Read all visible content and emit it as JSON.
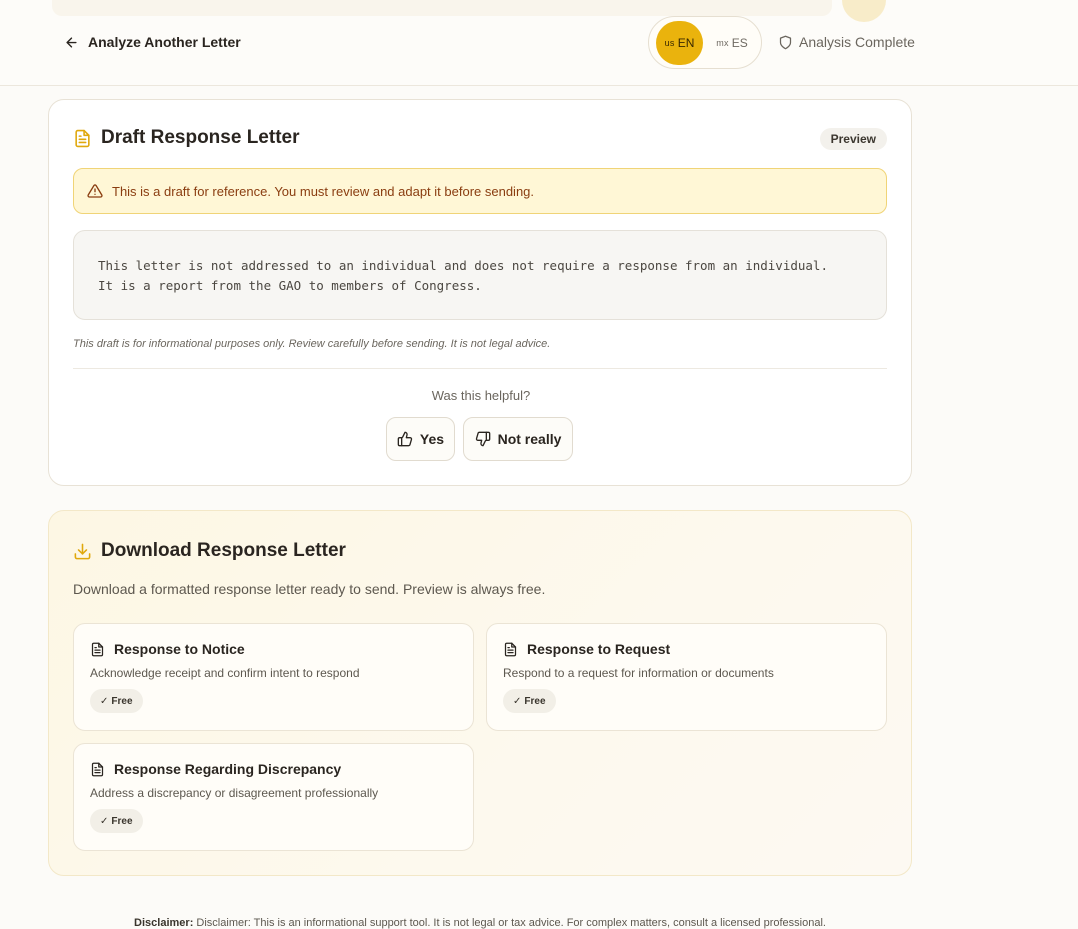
{
  "header": {
    "back_label": "Analyze Another Letter",
    "languages": [
      {
        "flag": "us",
        "code": "EN",
        "active": true
      },
      {
        "flag": "mx",
        "code": "ES",
        "active": false
      }
    ],
    "status": "Analysis Complete"
  },
  "draft": {
    "title": "Draft Response Letter",
    "badge": "Preview",
    "warning": "This is a draft for reference. You must review and adapt it before sending.",
    "letter_lines": [
      "This letter is not addressed to an individual and does not require a response from an individual.",
      "It is a report from the GAO to members of Congress."
    ],
    "note": "This draft is for informational purposes only. Review carefully before sending. It is not legal advice.",
    "feedback": {
      "question": "Was this helpful?",
      "yes": "Yes",
      "no": "Not really"
    }
  },
  "download": {
    "title": "Download Response Letter",
    "description": "Download a formatted response letter ready to send. Preview is always free.",
    "options": [
      {
        "title": "Response to Notice",
        "description": "Acknowledge receipt and confirm intent to respond",
        "badge": "Free",
        "check": "✓"
      },
      {
        "title": "Response to Request",
        "description": "Respond to a request for information or documents",
        "badge": "Free",
        "check": "✓"
      },
      {
        "title": "Response Regarding Discrepancy",
        "description": "Address a discrepancy or disagreement professionally",
        "badge": "Free",
        "check": "✓"
      }
    ]
  },
  "footer": {
    "label": "Disclaimer:",
    "text": "Disclaimer: This is an informational support tool. It is not legal or tax advice. For complex matters, consult a licensed professional."
  },
  "colors": {
    "accent": "#eab30d",
    "warning_bg": "#fff7d6",
    "warning_text": "#8a3d10"
  }
}
